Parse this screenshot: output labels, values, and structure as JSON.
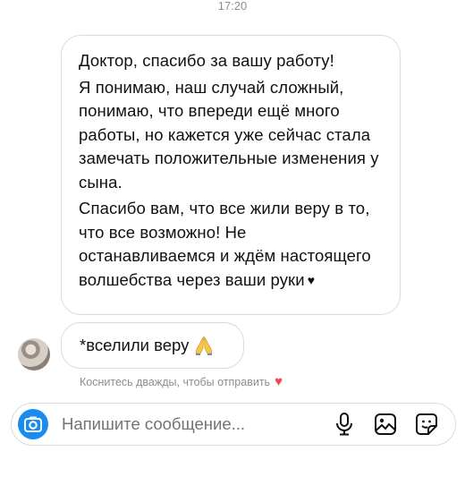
{
  "header": {
    "time": "17:20"
  },
  "thread": {
    "main_message": {
      "paragraphs": [
        "Доктор, спасибо за вашу работу!",
        "Я понимаю, наш случай сложный, понимаю, что впереди ещё много работы, но кажется уже сейчас стала замечать положительные изменения у сына.",
        "Спасибо вам, что все жили веру в то, что все возможно! Не останавливаемся и ждём настоящего волшебства через ваши руки"
      ],
      "end_emoji": "♥"
    },
    "reply": {
      "text": "*вселили веру",
      "emoji_icon": "folded-hands"
    },
    "hint": {
      "text": "Коснитесь дважды, чтобы отправить",
      "emoji": "♥"
    }
  },
  "composer": {
    "placeholder": "Напишите сообщение...",
    "camera_icon": "camera-icon",
    "mic_icon": "microphone-icon",
    "gallery_icon": "gallery-icon",
    "sticker_icon": "sticker-icon",
    "camera_color": "#1a8cf0"
  }
}
